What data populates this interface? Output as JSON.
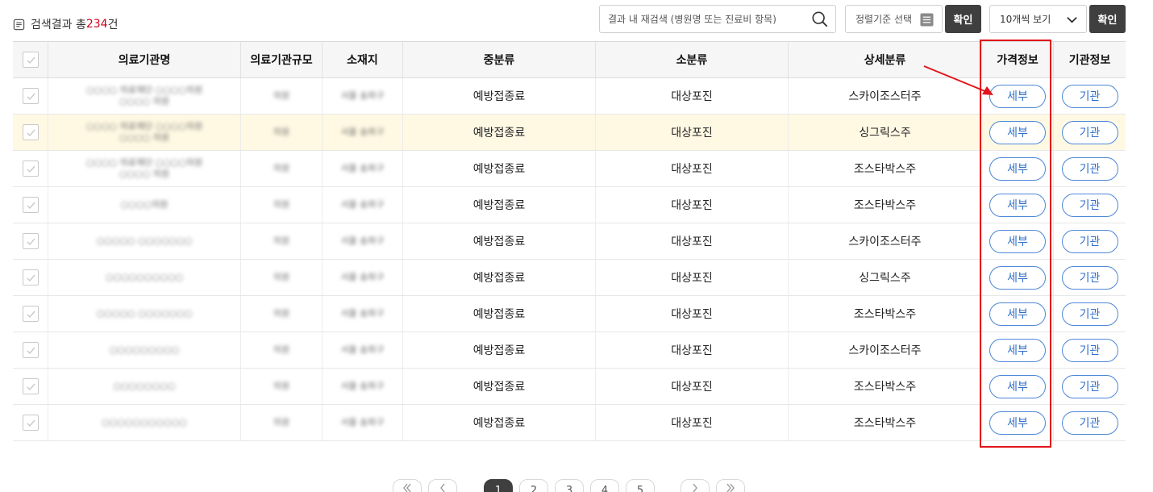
{
  "summary": {
    "prefix": "검색결과 총 ",
    "count": "234",
    "suffix": "건"
  },
  "toolbar": {
    "search_placeholder": "결과 내 재검색 (병원명 또는 진료비 항목)",
    "sort_label": "정렬기준 선택",
    "confirm_label": "확인",
    "per_page_label": "10개씩 보기"
  },
  "table": {
    "headers": [
      "의료기관명",
      "의료기관규모",
      "소재지",
      "중분류",
      "소분류",
      "상세분류",
      "가격정보",
      "기관정보"
    ],
    "rows": [
      {
        "name": "○○○○ 의료재단 ○○○○의원\n○○○○ 의원",
        "size": "의원",
        "location": "서울 송파구",
        "mid": "예방접종료",
        "sub": "대상포진",
        "detail": "스카이조스터주",
        "price_btn": "세부",
        "org_btn": "기관"
      },
      {
        "name": "○○○○ 의료재단 ○○○○의원\n○○○○ 의원",
        "size": "의원",
        "location": "서울 송파구",
        "mid": "예방접종료",
        "sub": "대상포진",
        "detail": "싱그릭스주",
        "price_btn": "세부",
        "org_btn": "기관"
      },
      {
        "name": "○○○○ 의료재단 ○○○○의원\n○○○○ 의원",
        "size": "의원",
        "location": "서울 송파구",
        "mid": "예방접종료",
        "sub": "대상포진",
        "detail": "조스타박스주",
        "price_btn": "세부",
        "org_btn": "기관"
      },
      {
        "name": "○○○○의원",
        "size": "의원",
        "location": "서울 송파구",
        "mid": "예방접종료",
        "sub": "대상포진",
        "detail": "조스타박스주",
        "price_btn": "세부",
        "org_btn": "기관"
      },
      {
        "name": "○○○○○ ○○○○○○○",
        "size": "의원",
        "location": "서울 송파구",
        "mid": "예방접종료",
        "sub": "대상포진",
        "detail": "스카이조스터주",
        "price_btn": "세부",
        "org_btn": "기관"
      },
      {
        "name": "○○○○○○○○○○",
        "size": "의원",
        "location": "서울 송파구",
        "mid": "예방접종료",
        "sub": "대상포진",
        "detail": "싱그릭스주",
        "price_btn": "세부",
        "org_btn": "기관"
      },
      {
        "name": "○○○○○ ○○○○○○○",
        "size": "의원",
        "location": "서울 송파구",
        "mid": "예방접종료",
        "sub": "대상포진",
        "detail": "조스타박스주",
        "price_btn": "세부",
        "org_btn": "기관"
      },
      {
        "name": "○○○○○○○○○",
        "size": "의원",
        "location": "서울 송파구",
        "mid": "예방접종료",
        "sub": "대상포진",
        "detail": "스카이조스터주",
        "price_btn": "세부",
        "org_btn": "기관"
      },
      {
        "name": "○○○○○○○○",
        "size": "의원",
        "location": "서울 송파구",
        "mid": "예방접종료",
        "sub": "대상포진",
        "detail": "조스타박스주",
        "price_btn": "세부",
        "org_btn": "기관"
      },
      {
        "name": "○○○○○○○○○○○",
        "size": "의원",
        "location": "서울 송파구",
        "mid": "예방접종료",
        "sub": "대상포진",
        "detail": "조스타박스주",
        "price_btn": "세부",
        "org_btn": "기관"
      }
    ]
  },
  "highlighted_row": 1,
  "pagination": {
    "pages": [
      "1",
      "2",
      "3",
      "4",
      "5"
    ],
    "active": "1"
  },
  "colors": {
    "accent_red": "#e3141b",
    "pill_blue": "#2f6fcb",
    "dark_button": "#3f3f3f",
    "highlight_row": "#fff9e4"
  },
  "icons": {
    "summary": "document-icon",
    "search": "search-icon",
    "sort": "list-icon",
    "per_page": "chevron-down-icon",
    "checkbox": "check-icon"
  }
}
